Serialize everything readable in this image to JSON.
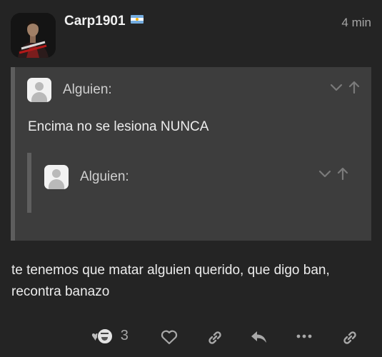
{
  "post": {
    "username": "Carp1901",
    "time": "4 min",
    "body": "te tenemos que matar alguien querido, que digo ban, recontra banazo"
  },
  "quote": {
    "author": "Alguien:",
    "text": "Encima no se lesiona NUNCA",
    "nested": {
      "author": "Alguien:"
    }
  },
  "actions": {
    "reaction_count": "3",
    "icons": [
      "heart-icon",
      "laugh-icon",
      "like-heart-icon",
      "copy-link-icon",
      "reply-icon",
      "more-icon",
      "share-link-icon"
    ]
  },
  "colors": {
    "background": "#242424",
    "quote_background": "#3d3d3d",
    "quote_border": "#5d5d5d",
    "muted": "#a5a5a5"
  }
}
